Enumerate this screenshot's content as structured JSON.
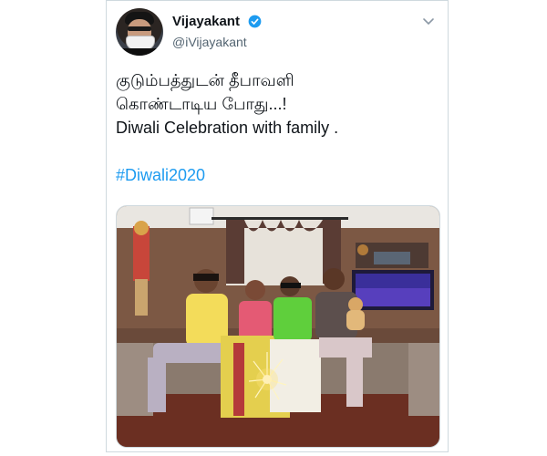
{
  "tweet": {
    "author": {
      "display_name": "Vijayakant",
      "handle": "@iVijayakant",
      "verified": true,
      "avatar_icon": "user-avatar-icon"
    },
    "text_lines": [
      "குடும்பத்துடன் தீபாவளி",
      "கொண்டாடிய போது...!",
      "Diwali Celebration with family ."
    ],
    "hashtag": "#Diwali2020",
    "media": {
      "type": "photo",
      "alt_icon": "family-photo-image"
    }
  },
  "colors": {
    "accent": "#1d9bf0",
    "text": "#0f1419",
    "secondary": "#536471",
    "border": "#cfd9de"
  }
}
